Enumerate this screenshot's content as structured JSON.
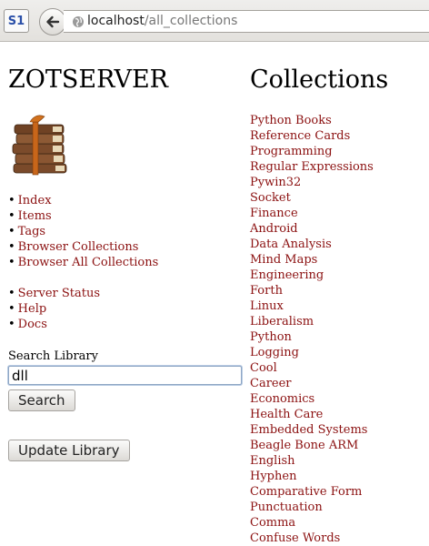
{
  "browser": {
    "tab_icon": "S1",
    "url_host": "localhost",
    "url_path": "/all_collections"
  },
  "page": {
    "title": "ZOTSERVER",
    "nav_primary": [
      "Index",
      "Items",
      "Tags",
      "Browser Collections",
      "Browser All Collections"
    ],
    "nav_secondary": [
      "Server Status",
      "Help",
      "Docs"
    ],
    "search": {
      "label": "Search Library",
      "value": "dll",
      "button": "Search"
    },
    "update_button": "Update Library"
  },
  "collections": {
    "heading": "Collections",
    "items": [
      "Python Books",
      "Reference Cards",
      "Programming",
      "Regular Expressions",
      "Pywin32",
      "Socket",
      "Finance",
      "Android",
      "Data Analysis",
      "Mind Maps",
      "Engineering",
      "Forth",
      "Linux",
      "Liberalism",
      "Python",
      "Logging",
      "Cool",
      "Career",
      "Economics",
      "Health Care",
      "Embedded Systems",
      "Beagle Bone ARM",
      "English",
      "Hyphen",
      "Comparative Form",
      "Punctuation",
      "Comma",
      "Confuse Words"
    ]
  },
  "colors": {
    "link": "#8b1010"
  },
  "icons": [
    "site-favicon-icon",
    "back-arrow-icon",
    "globe-icon",
    "book-stack-logo"
  ]
}
